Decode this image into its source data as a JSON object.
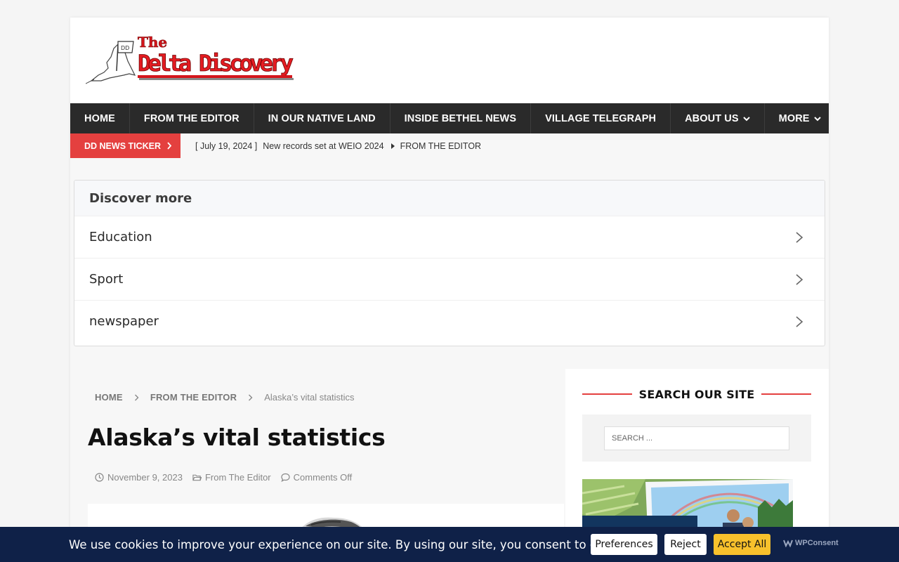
{
  "site": {
    "logo_top": "The",
    "logo_main": "Delta Discovery"
  },
  "nav": {
    "items": [
      {
        "label": "HOME"
      },
      {
        "label": "FROM THE EDITOR"
      },
      {
        "label": "IN OUR NATIVE LAND"
      },
      {
        "label": "INSIDE BETHEL NEWS"
      },
      {
        "label": "VILLAGE TELEGRAPH"
      },
      {
        "label": "ABOUT US"
      },
      {
        "label": "MORE"
      }
    ]
  },
  "ticker": {
    "label": "DD NEWS TICKER",
    "date": "[ July 19, 2024 ]",
    "headline": "New records set at WEIO 2024",
    "category": "FROM THE EDITOR"
  },
  "discover": {
    "heading": "Discover more",
    "items": [
      "Education",
      "Sport",
      "newspaper"
    ]
  },
  "breadcrumb": {
    "home": "HOME",
    "section": "FROM THE EDITOR",
    "current": "Alaska’s vital statistics"
  },
  "article": {
    "title": "Alaska’s vital statistics",
    "date": "November 9, 2023",
    "category": "From The Editor",
    "comments": "Comments Off"
  },
  "sidebar": {
    "search_title": "SEARCH OUR SITE",
    "search_placeholder": "SEARCH ..."
  },
  "cookie": {
    "text": "We use cookies to improve your experience on our site. By using our site, you consent to cookies.",
    "preferences": "Preferences",
    "reject": "Reject",
    "accept": "Accept All",
    "brand": "WPConsent"
  },
  "colors": {
    "accent_red": "#e4403f",
    "nav_bg": "#2a2a2a",
    "cookie_bg": "#0f2148",
    "accept_yellow": "#f8c12c"
  }
}
